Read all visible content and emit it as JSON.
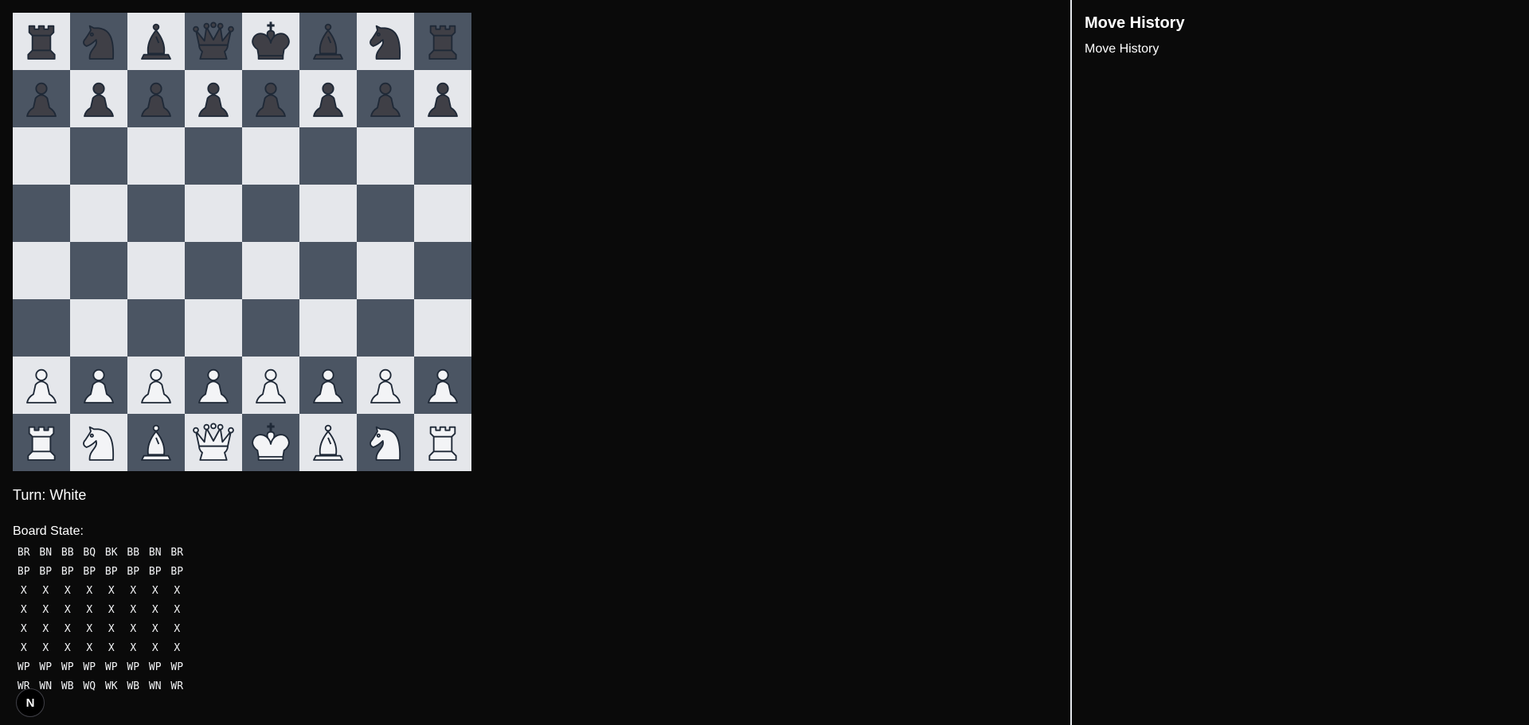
{
  "colors": {
    "background": "#0a0a0a",
    "light_square": "#e5e7eb",
    "dark_square": "#4b5563",
    "white_piece_fill": "#f3f4f6",
    "black_piece_fill": "#3f3f46",
    "piece_outline": "#1f2937"
  },
  "board": {
    "rows": [
      [
        "BR",
        "BN",
        "BB",
        "BQ",
        "BK",
        "BB",
        "BN",
        "BR"
      ],
      [
        "BP",
        "BP",
        "BP",
        "BP",
        "BP",
        "BP",
        "BP",
        "BP"
      ],
      [
        "X",
        "X",
        "X",
        "X",
        "X",
        "X",
        "X",
        "X"
      ],
      [
        "X",
        "X",
        "X",
        "X",
        "X",
        "X",
        "X",
        "X"
      ],
      [
        "X",
        "X",
        "X",
        "X",
        "X",
        "X",
        "X",
        "X"
      ],
      [
        "X",
        "X",
        "X",
        "X",
        "X",
        "X",
        "X",
        "X"
      ],
      [
        "WP",
        "WP",
        "WP",
        "WP",
        "WP",
        "WP",
        "WP",
        "WP"
      ],
      [
        "WR",
        "WN",
        "WB",
        "WQ",
        "WK",
        "WB",
        "WN",
        "WR"
      ]
    ]
  },
  "status": {
    "turn_text": "Turn: White",
    "board_state_label": "Board State:"
  },
  "sidebar": {
    "title": "Move History",
    "subtitle": "Move History"
  },
  "badge": {
    "icon": "nextjs-logo-icon",
    "letter": "N"
  }
}
